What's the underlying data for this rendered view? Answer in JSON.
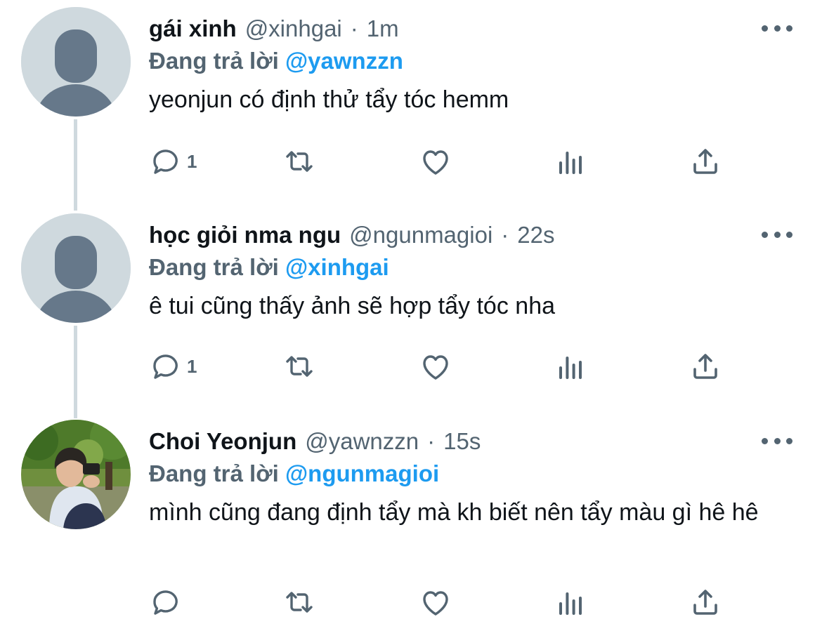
{
  "tweets": [
    {
      "name": "gái xinh",
      "handle": "@xinhgai",
      "time": "1m",
      "replying_prefix": "Đang trả lời",
      "replying_to": "@yawnzzn",
      "text": "yeonjun có định thử tẩy tóc hemm",
      "reply_count": "1",
      "avatar": "default-avatar"
    },
    {
      "name": "học giỏi nma ngu",
      "handle": "@ngunmagioi",
      "time": "22s",
      "replying_prefix": "Đang trả lời",
      "replying_to": "@xinhgai",
      "text": "ê tui cũng thấy ảnh sẽ hợp tẩy tóc nha",
      "reply_count": "1",
      "avatar": "default-avatar"
    },
    {
      "name": "Choi Yeonjun",
      "handle": "@yawnzzn",
      "time": "15s",
      "replying_prefix": "Đang trả lời",
      "replying_to": "@ngunmagioi",
      "text": "mình cũng đang định tẩy mà kh biết nên tẩy màu gì hê hê",
      "reply_count": "",
      "avatar": "photo-avatar"
    }
  ],
  "separator": "·",
  "icons": [
    "reply-icon",
    "retweet-icon",
    "like-icon",
    "analytics-icon",
    "share-icon",
    "more-icon"
  ],
  "colors": {
    "accent": "#1d9bf0",
    "secondary": "#536471",
    "thread_line": "#cfd9de"
  }
}
